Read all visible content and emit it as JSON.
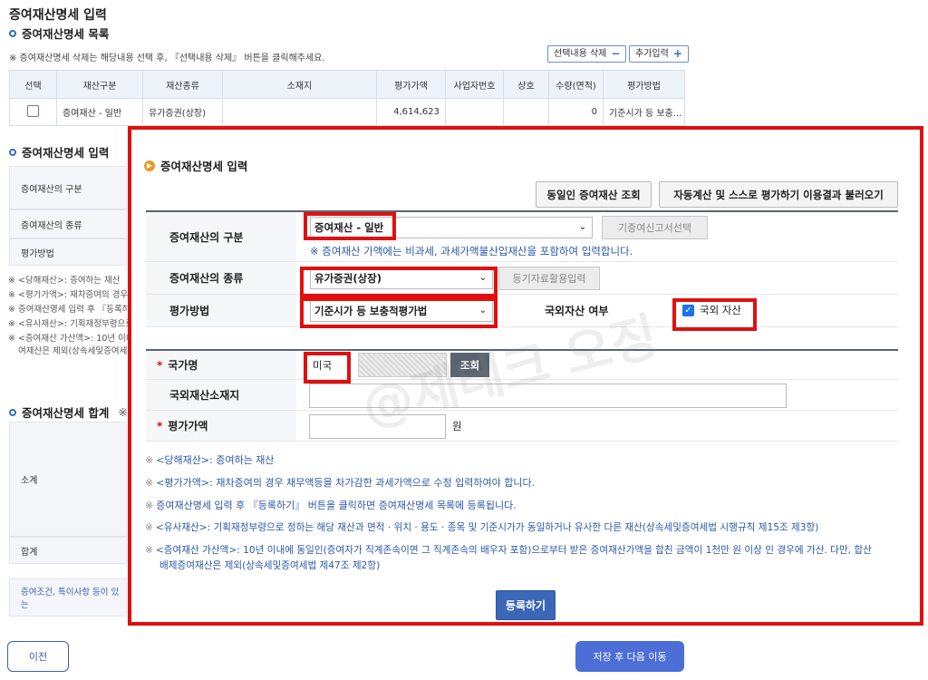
{
  "page": {
    "title": "증여재산명세 입력"
  },
  "list_section": {
    "heading": "증여재산명세 목록",
    "note": "※ 증여재산명세 삭제는 해당내용 선택 후, 『선택내용 삭제』 버튼을 클릭해주세요.",
    "delete_button": "선택내용 삭제",
    "delete_symbol": "−",
    "add_button": "추가입력",
    "add_symbol": "+",
    "columns": [
      "선택",
      "재산구분",
      "재산종류",
      "소재지",
      "평가가액",
      "사업자번호",
      "상호",
      "수량(면적)",
      "평가방법"
    ],
    "rows": [
      {
        "category": "증여재산 - 일반",
        "type": "유가증권(상장)",
        "location": "",
        "value": "4,614,623",
        "biz_no": "",
        "company": "",
        "quantity": "0",
        "method": "기준시가 등 보충..."
      }
    ]
  },
  "input_section_bg": {
    "heading": "증여재산명세 입력",
    "labels": [
      "증여재산의 구분",
      "증여재산의 종류",
      "평가방법"
    ],
    "notes": [
      "※ <당해재산>: 증여하는 재산",
      "※ <평가가액>: 재차증여의 경우",
      "※ 증여재산명세 입력 후 『등록하",
      "※ <유사재산>: 기획재정부령으로",
      "※ <증여재산 가산액>: 10년 이내",
      "여재산은 제외(상속세및증여세"
    ]
  },
  "summary_section_bg": {
    "heading": "증여재산명세 합계",
    "heading_suffix": "※",
    "subtotal_label": "소계",
    "total_label": "합계",
    "note": "증여조건, 특이사항 등이 있는"
  },
  "footer": {
    "prev_button": "이전",
    "next_button": "저장 후 다음 이동"
  },
  "popup": {
    "title": "증여재산명세 입력",
    "btn_lookup": "동일인 증여재산 조회",
    "btn_auto": "자동계산 및 스스로 평가하기 이용결과 불러오기",
    "fields": {
      "category_label": "증여재산의 구분",
      "category_value": "증여재산 - 일반",
      "category_btn": "기증여신고서선택",
      "category_info": "※ 증여재산 가액에는 비과세, 과세가액불산입재산을 포함하여 입력합니다.",
      "type_label": "증여재산의 종류",
      "type_value": "유가증권(상장)",
      "type_btn": "등기자료활용입력",
      "method_label": "평가방법",
      "method_value": "기준시가 등 보충적평가법",
      "foreign_label": "국외자산 여부",
      "foreign_checkbox_label": "국외 자산",
      "foreign_checked": true,
      "country_label": "국가명",
      "country_value": "미국",
      "country_btn": "조회",
      "foreign_location_label": "국외재산소재지",
      "foreign_location_value": "",
      "value_label": "평가가액",
      "value_value": "",
      "value_unit": "원"
    },
    "notes": [
      "<당해재산>: 증여하는 재산",
      "<평가가액>: 재차증여의 경우 채무액등을 차가감한 과세가액으로 수정 입력하여야 합니다.",
      "증여재산명세 입력 후 『등록하기』 버튼을 클릭하면 증여재산명세 목록에 등록됩니다.",
      "<유사재산>: 기획재정부령으로 정하는 해당 재산과 면적 · 위치 · 용도 · 종목 및 기준시가가 동일하거나 유사한 다른 재산(상속세및증여세법 시행규칙 제15조 제3항)",
      "<증여재산 가산액>: 10년 이내에 동일인(증여자가 직계존속이면 그 직계존속의 배우자 포함)으로부터 받은 증여재산가액을 합친 금액이 1천만 원 이상 인 경우에 가산. 다만, 합산",
      "배제증여재산은 제외(상속세및증여세법 제47조 제2항)"
    ],
    "note_mark": "※",
    "register_button": "등록하기",
    "watermark": "@제테크 오징"
  },
  "colors": {
    "highlight_red": "#e01010",
    "primary_blue": "#3b67b8",
    "info_blue": "#2b58a8"
  }
}
